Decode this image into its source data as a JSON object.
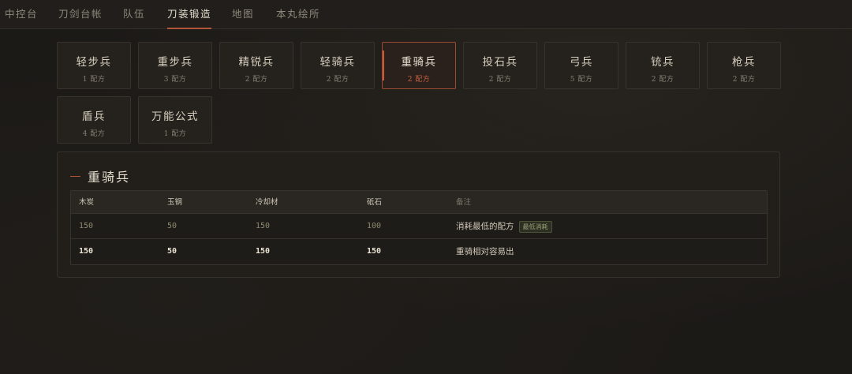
{
  "nav": {
    "items": [
      {
        "label": "中控台"
      },
      {
        "label": "刀剑台帐"
      },
      {
        "label": "队伍"
      },
      {
        "label": "刀装锻造"
      },
      {
        "label": "地图"
      },
      {
        "label": "本丸绘所"
      }
    ],
    "active_index": 3
  },
  "cards": [
    {
      "title": "轻步兵",
      "sub": "1 配方"
    },
    {
      "title": "重步兵",
      "sub": "3 配方"
    },
    {
      "title": "精锐兵",
      "sub": "2 配方"
    },
    {
      "title": "轻骑兵",
      "sub": "2 配方"
    },
    {
      "title": "重骑兵",
      "sub": "2 配方"
    },
    {
      "title": "投石兵",
      "sub": "2 配方"
    },
    {
      "title": "弓兵",
      "sub": "5 配方"
    },
    {
      "title": "铳兵",
      "sub": "2 配方"
    },
    {
      "title": "枪兵",
      "sub": "2 配方"
    },
    {
      "title": "盾兵",
      "sub": "4 配方"
    },
    {
      "title": "万能公式",
      "sub": "1 配方"
    }
  ],
  "selected_card_index": 4,
  "panel": {
    "title": "重骑兵",
    "headers": [
      "木炭",
      "玉钢",
      "冷却材",
      "砥石",
      "备注"
    ],
    "rows": [
      {
        "values": [
          "150",
          "50",
          "150",
          "100"
        ],
        "note": "消耗最低的配方",
        "tag": "最低消耗"
      },
      {
        "values": [
          "150",
          "50",
          "150",
          "150"
        ],
        "note": "重骑相对容易出",
        "tag": ""
      }
    ]
  },
  "colors": {
    "accent": "#b3553a",
    "background": "#1c1a17",
    "card": "#25221e",
    "tag_green": "#9ca27a"
  }
}
